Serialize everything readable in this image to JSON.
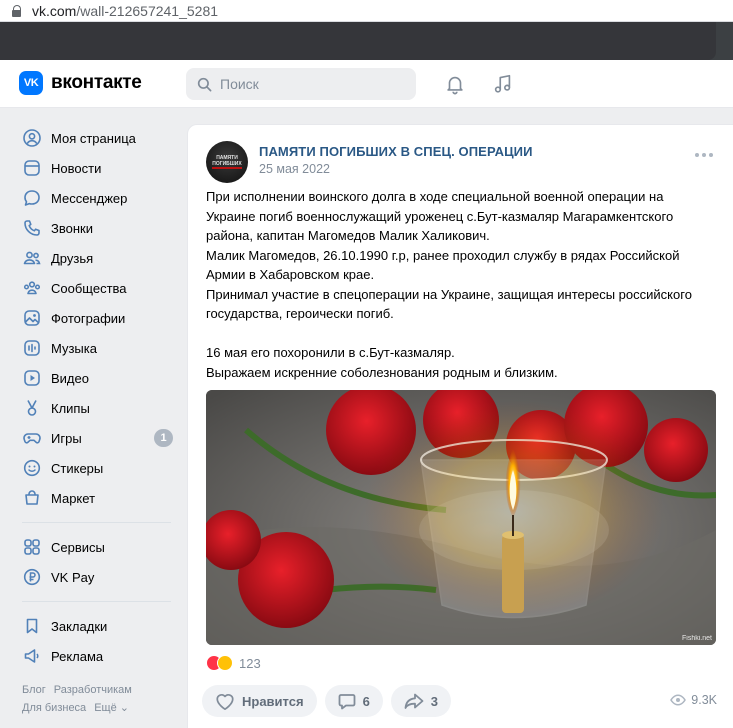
{
  "browser": {
    "url_host": "vk.com",
    "url_path": "/wall-212657241_5281"
  },
  "header": {
    "logo_mark": "VK",
    "logo_text": "вконтакте",
    "search_placeholder": "Поиск"
  },
  "sidebar": {
    "items": [
      {
        "label": "Моя страница",
        "icon": "user-circle-icon"
      },
      {
        "label": "Новости",
        "icon": "news-icon"
      },
      {
        "label": "Мессенджер",
        "icon": "message-icon"
      },
      {
        "label": "Звонки",
        "icon": "phone-icon"
      },
      {
        "label": "Друзья",
        "icon": "friends-icon"
      },
      {
        "label": "Сообщества",
        "icon": "communities-icon"
      },
      {
        "label": "Фотографии",
        "icon": "photo-icon"
      },
      {
        "label": "Музыка",
        "icon": "music-icon"
      },
      {
        "label": "Видео",
        "icon": "video-icon"
      },
      {
        "label": "Клипы",
        "icon": "clips-icon"
      },
      {
        "label": "Игры",
        "icon": "games-icon",
        "badge": "1"
      },
      {
        "label": "Стикеры",
        "icon": "sticker-icon"
      },
      {
        "label": "Маркет",
        "icon": "market-icon"
      }
    ],
    "items2": [
      {
        "label": "Сервисы",
        "icon": "services-icon"
      },
      {
        "label": "VK Pay",
        "icon": "vkpay-icon"
      }
    ],
    "items3": [
      {
        "label": "Закладки",
        "icon": "bookmark-icon"
      },
      {
        "label": "Реклама",
        "icon": "ads-icon"
      }
    ],
    "footer_row1": [
      "Блог",
      "Разработчикам"
    ],
    "footer_row2": [
      "Для бизнеса",
      "Ещё ⌄"
    ]
  },
  "post": {
    "group_name": "ПАМЯТИ ПОГИБШИХ В СПЕЦ. ОПЕРАЦИИ",
    "avatar_text": "ПАМЯТИ ПОГИБШИХ",
    "date": "25 мая 2022",
    "text": [
      "При исполнении воинского долга в ходе специальной военной операции на",
      "Украине погиб военнослужащий уроженец с.Бут-казмаляр Магарамкентского",
      "района, капитан Магомедов Малик Халикович.",
      "Малик Магомедов, 26.10.1990 г.р, ранее проходил службу в рядах Российской",
      "Армии в Хабаровском крае.",
      "Принимал участие в спецоперации на Украине, защищая интересы российского",
      "государства, героически погиб.",
      "",
      "16 мая его похоронили в с.Бут-казмаляр.",
      "Выражаем искренние соболезнования родным и близким."
    ],
    "photo_credit": "Fishki.net",
    "reactions_count": "123",
    "like_label": "Нравится",
    "comments_count": "6",
    "shares_count": "3",
    "views_count": "9.3K"
  },
  "colors": {
    "accent": "#0077ff",
    "link": "#2a5885",
    "muted": "#818c99",
    "background": "#edeef0"
  }
}
